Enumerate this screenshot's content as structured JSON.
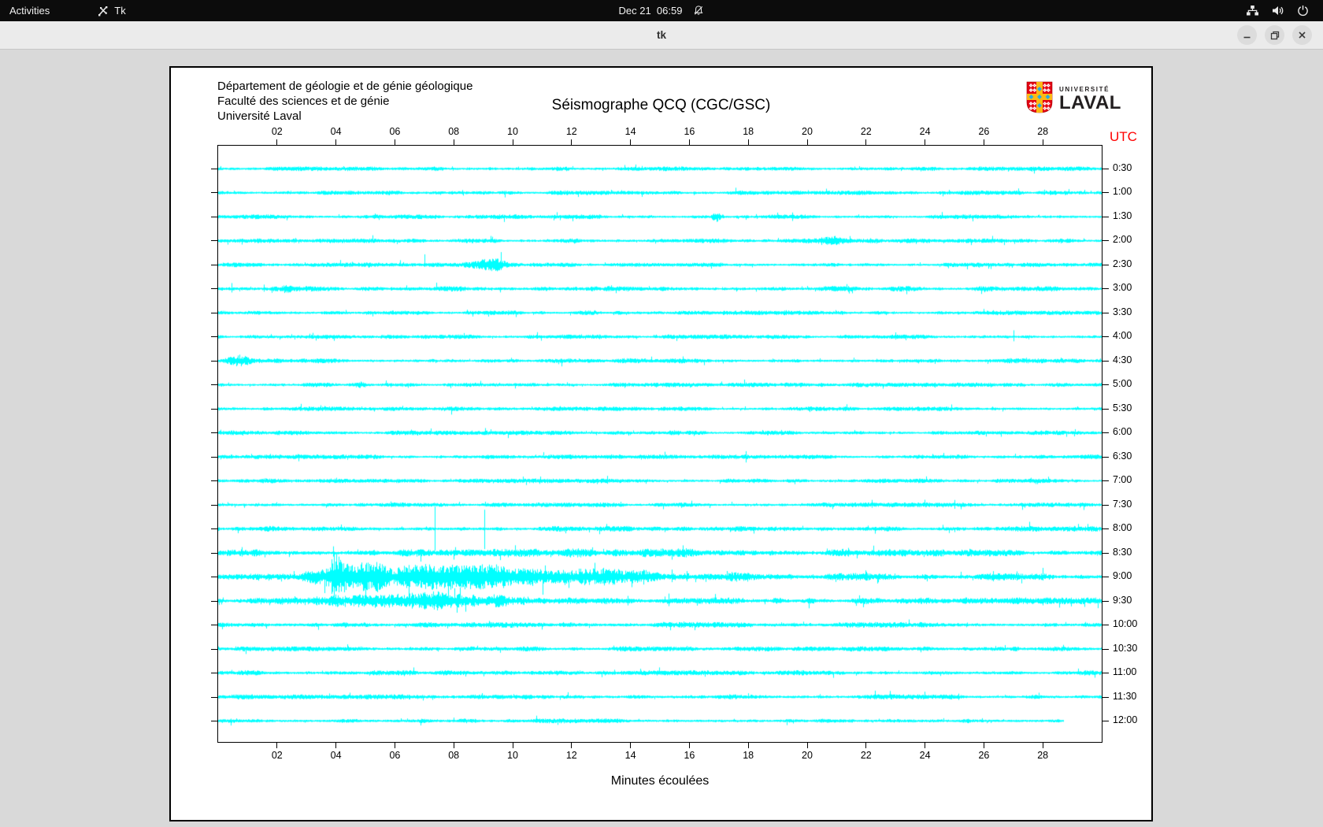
{
  "topbar": {
    "activities_label": "Activities",
    "app_label": "Tk",
    "clock": "Dec 21  06:59"
  },
  "titlebar": {
    "title": "tk"
  },
  "canvas_header": {
    "dept": "Département de géologie et de génie géologique",
    "faculty": "Faculté des sciences et de génie",
    "university": "Université Laval",
    "title": "Séismographe QCQ (CGC/GSC)"
  },
  "logo": {
    "top": "UNIVERSITÉ",
    "name": "LAVAL"
  },
  "axis": {
    "minute_ticks": [
      "02",
      "04",
      "06",
      "08",
      "10",
      "12",
      "14",
      "16",
      "18",
      "20",
      "22",
      "24",
      "26",
      "28"
    ],
    "utc": "UTC",
    "xlabel": "Minutes écoulées"
  },
  "chart_data": {
    "type": "line",
    "title": "Séismographe QCQ (CGC/GSC)",
    "x_label": "Minutes écoulées",
    "x_unit": "minutes",
    "x_range": [
      0,
      30
    ],
    "trace_color": "#00ffff",
    "rows": [
      {
        "label": "0:30",
        "base": 1.6,
        "events": [
          {
            "m": 11.6,
            "a": 3,
            "w": 0.3
          }
        ],
        "spikes": []
      },
      {
        "label": "1:00",
        "base": 1.6,
        "events": [],
        "spikes": []
      },
      {
        "label": "1:30",
        "base": 1.6,
        "events": [
          {
            "m": 16.9,
            "a": 4,
            "w": 0.2
          }
        ],
        "spikes": []
      },
      {
        "label": "2:00",
        "base": 1.6,
        "events": [
          {
            "m": 20.7,
            "a": 3,
            "w": 0.4
          }
        ],
        "spikes": []
      },
      {
        "label": "2:30",
        "base": 1.6,
        "events": [
          {
            "m": 9.25,
            "a": 4,
            "w": 0.55
          }
        ],
        "spikes": [
          {
            "m": 7.0,
            "u": 13,
            "d": 3
          }
        ]
      },
      {
        "label": "3:00",
        "base": 2.0,
        "events": [
          {
            "m": 2.4,
            "a": 3,
            "w": 0.6
          }
        ],
        "spikes": [
          {
            "m": 0.45,
            "u": 7,
            "d": 5
          },
          {
            "m": 1.55,
            "u": 5,
            "d": 4
          }
        ]
      },
      {
        "label": "3:30",
        "base": 1.6,
        "events": [],
        "spikes": []
      },
      {
        "label": "4:00",
        "base": 1.6,
        "events": [],
        "spikes": [
          {
            "m": 27.0,
            "u": 8,
            "d": 6
          }
        ]
      },
      {
        "label": "4:30",
        "base": 1.8,
        "events": [
          {
            "m": 0.6,
            "a": 3,
            "w": 0.4
          }
        ],
        "spikes": []
      },
      {
        "label": "5:00",
        "base": 1.6,
        "events": [
          {
            "m": 4.8,
            "a": 3,
            "w": 0.2
          }
        ],
        "spikes": []
      },
      {
        "label": "5:30",
        "base": 1.6,
        "events": [],
        "spikes": []
      },
      {
        "label": "6:00",
        "base": 1.6,
        "events": [],
        "spikes": []
      },
      {
        "label": "6:30",
        "base": 1.6,
        "events": [],
        "spikes": []
      },
      {
        "label": "7:00",
        "base": 1.6,
        "events": [],
        "spikes": [
          {
            "m": 13.2,
            "u": 6,
            "d": 4
          }
        ]
      },
      {
        "label": "7:30",
        "base": 1.6,
        "events": [],
        "spikes": [
          {
            "m": 22.2,
            "u": 6,
            "d": 4
          }
        ]
      },
      {
        "label": "8:00",
        "base": 2.0,
        "events": [],
        "spikes": [
          {
            "m": 7.35,
            "u": 28,
            "d": 28
          },
          {
            "m": 9.05,
            "u": 24,
            "d": 26
          }
        ]
      },
      {
        "label": "8:30",
        "base": 2.4,
        "events": [
          {
            "m": 14,
            "a": 1,
            "w": 8
          }
        ],
        "spikes": [
          {
            "m": 0.8,
            "u": 7,
            "d": 5
          },
          {
            "m": 3.9,
            "u": 8,
            "d": 5
          },
          {
            "m": 21.4,
            "u": 6,
            "d": 5
          },
          {
            "m": 24.6,
            "u": 4,
            "d": 4
          }
        ]
      },
      {
        "label": "9:00",
        "base": 2.6,
        "events": [
          {
            "m": 3.9,
            "a": 18,
            "w": 0.25
          },
          {
            "m": 4.6,
            "a": 6,
            "w": 1.5
          },
          {
            "m": 7,
            "a": 5,
            "w": 4
          },
          {
            "m": 12,
            "a": 4,
            "w": 5
          }
        ],
        "spikes": [
          {
            "m": 3.85,
            "u": 22,
            "d": 22
          },
          {
            "m": 5.0,
            "u": 10,
            "d": 8
          },
          {
            "m": 6.6,
            "u": 9,
            "d": 7
          },
          {
            "m": 8.0,
            "u": 12,
            "d": 10
          },
          {
            "m": 9.15,
            "u": 13,
            "d": 11
          },
          {
            "m": 10.3,
            "u": 8,
            "d": 6
          },
          {
            "m": 11.2,
            "u": 7,
            "d": 7
          },
          {
            "m": 12.0,
            "u": 8,
            "d": 6
          },
          {
            "m": 13.4,
            "u": 7,
            "d": 9
          },
          {
            "m": 15.4,
            "u": 9,
            "d": 7
          },
          {
            "m": 15.9,
            "u": 7,
            "d": 6
          },
          {
            "m": 22.0,
            "u": 6,
            "d": 5
          },
          {
            "m": 26.3,
            "u": 7,
            "d": 6
          },
          {
            "m": 27.1,
            "u": 6,
            "d": 5
          },
          {
            "m": 28.0,
            "u": 5,
            "d": 5
          }
        ]
      },
      {
        "label": "9:30",
        "base": 2.4,
        "events": [
          {
            "m": 5.5,
            "a": 4,
            "w": 2
          },
          {
            "m": 8,
            "a": 4,
            "w": 2
          }
        ],
        "spikes": [
          {
            "m": 4.3,
            "u": 6,
            "d": 8
          },
          {
            "m": 6.9,
            "u": 7,
            "d": 9
          },
          {
            "m": 7.6,
            "u": 6,
            "d": 10
          },
          {
            "m": 13.9,
            "u": 6,
            "d": 6
          },
          {
            "m": 15.3,
            "u": 9,
            "d": 7
          }
        ]
      },
      {
        "label": "10:00",
        "base": 2.0,
        "events": [],
        "spikes": [
          {
            "m": 15.8,
            "u": 4,
            "d": 4
          },
          {
            "m": 17.0,
            "u": 3,
            "d": 3
          }
        ]
      },
      {
        "label": "10:30",
        "base": 1.8,
        "events": [],
        "spikes": []
      },
      {
        "label": "11:00",
        "base": 1.8,
        "events": [],
        "spikes": []
      },
      {
        "label": "11:30",
        "base": 1.8,
        "events": [],
        "spikes": []
      },
      {
        "label": "12:00",
        "base": 1.8,
        "events": [],
        "spikes": [],
        "end": 28.7
      }
    ]
  }
}
